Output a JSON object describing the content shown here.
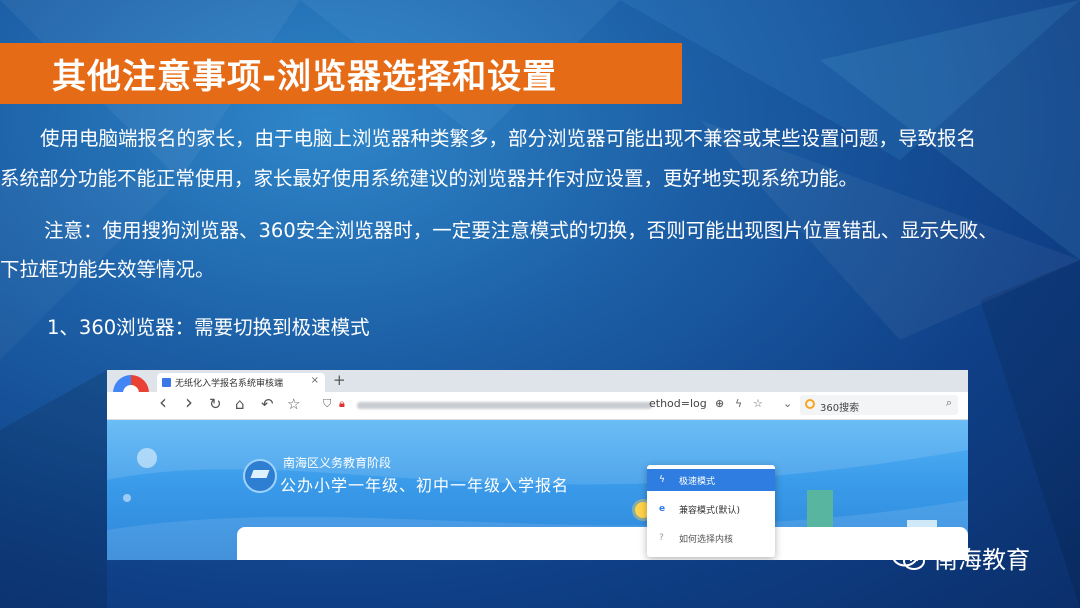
{
  "slide": {
    "title": "其他注意事项-浏览器选择和设置",
    "para1_line1": "使用电脑端报名的家长，由于电脑上浏览器种类繁多，部分浏览器可能出现不兼容或某些设置问题，导致报名",
    "para1_line2": "系统部分功能不能正常使用，家长最好使用系统建议的浏览器并作对应设置，更好地实现系统功能。",
    "para2_line1": "注意：使用搜狗浏览器、360安全浏览器时，一定要注意模式的切换，否则可能出现图片位置错乱、显示失败、",
    "para2_line2": "下拉框功能失效等情况。",
    "item1": "1、360浏览器：需要切换到极速模式",
    "watermark": "南海教育",
    "colors": {
      "title_bg": "#e66b16",
      "background": "#1c5fa6",
      "text": "#ffffff"
    }
  },
  "browser": {
    "tab_title": "无纸化入学报名系统审核端",
    "tab_close": "×",
    "new_tab": "+",
    "nav": {
      "back": "‹",
      "forward": "›",
      "reload": "↻",
      "home": "⌂",
      "undo": "↶",
      "favorite": "☆"
    },
    "url_visible": "ethod=log",
    "search_placeholder": "360搜索",
    "page": {
      "line1": "南海区义务教育阶段",
      "line2": "公办小学一年级、初中一年级入学报名"
    },
    "mode_menu": [
      {
        "label": "极速模式",
        "icon": "bolt-icon",
        "selected": true
      },
      {
        "label": "兼容模式(默认)",
        "icon": "ie-icon",
        "selected": false
      },
      {
        "label": "如何选择内核",
        "icon": "help-icon",
        "selected": false
      }
    ]
  }
}
